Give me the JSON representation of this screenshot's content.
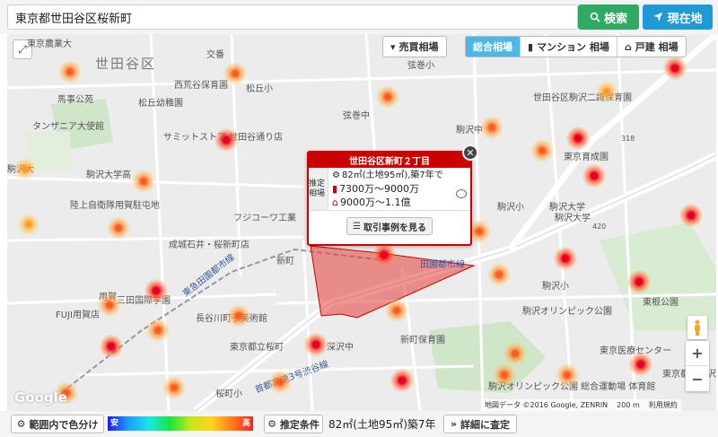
{
  "search": {
    "value": "東京都世田谷区桜新町",
    "search_label": "検索",
    "location_label": "現在地"
  },
  "map": {
    "price_button": "売買相場",
    "tabs": [
      "総合相場",
      "マンション 相場",
      "戸建 相場"
    ],
    "labels": {
      "ward": "世田谷区",
      "l1": "東京農業大",
      "l2": "交番",
      "l3": "西荒谷保育園",
      "l4": "馬事公苑",
      "l5": "松丘幼稚園",
      "l6": "タンザニア大使館",
      "l7": "サミットストア 世田谷通り店",
      "l8": "駒沢大学高",
      "l9": "陸上自衛隊用賀駐屯地",
      "l10": "成城石井・桜新町店",
      "l11": "フジコーワ工業",
      "l12": "東急田園都市線",
      "l13": "用賀",
      "l14": "FUJI用賀店",
      "l15": "三田国際学園",
      "l16": "長谷川町子美術館",
      "l17": "東京都立桜町",
      "l18": "桜町小",
      "l19": "深沢中",
      "l20": "新町保育園",
      "l21": "駒沢オリンピック公園",
      "l22": "駒沢オリンピック公園 総合運動場 体育館",
      "l23": "東京医療センター",
      "l24": "駒沢大学",
      "l25": "駒沢小",
      "l26": "新町",
      "l27": "東根公園",
      "l28": "首都高速3号渋谷線",
      "l29": "東京育成園",
      "l30": "世田谷区駒沢二諏保育園",
      "l31": "弦巻中",
      "l32": "松丘小",
      "l33": "弦巻小",
      "l34": "駒沢中",
      "l35": "田園都市線",
      "l36": "駒沢小",
      "l37": "駒沢大学",
      "l38": "318",
      "l39": "420",
      "l40": "駒沢大",
      "l41": "東京都立駒沢"
    },
    "popup": {
      "title": "世田谷区新町２丁目",
      "side_label": "推定相場",
      "condition": "82㎡(土地95㎡),築7年で",
      "mansion_range": "7300万〜9000万",
      "house_range": "9000万〜1.1億",
      "records_button": "取引事例を見る"
    },
    "attribution": "地図データ ©2016 Google, ZENRIN",
    "scale": "200 m",
    "terms": "利用規約",
    "google": "Google"
  },
  "toolbar": {
    "color_button": "範囲内で色分け",
    "scale_low": "安",
    "scale_high": "高",
    "condition_button": "推定条件",
    "condition_text": "82㎡(土地95㎡)築7年",
    "detail_button": "詳細に査定"
  },
  "colors": {
    "search_green": "#2eaa62",
    "location_blue": "#1f9ad6",
    "popup_red": "#cc0000",
    "active_tab": "#4db8e6"
  }
}
